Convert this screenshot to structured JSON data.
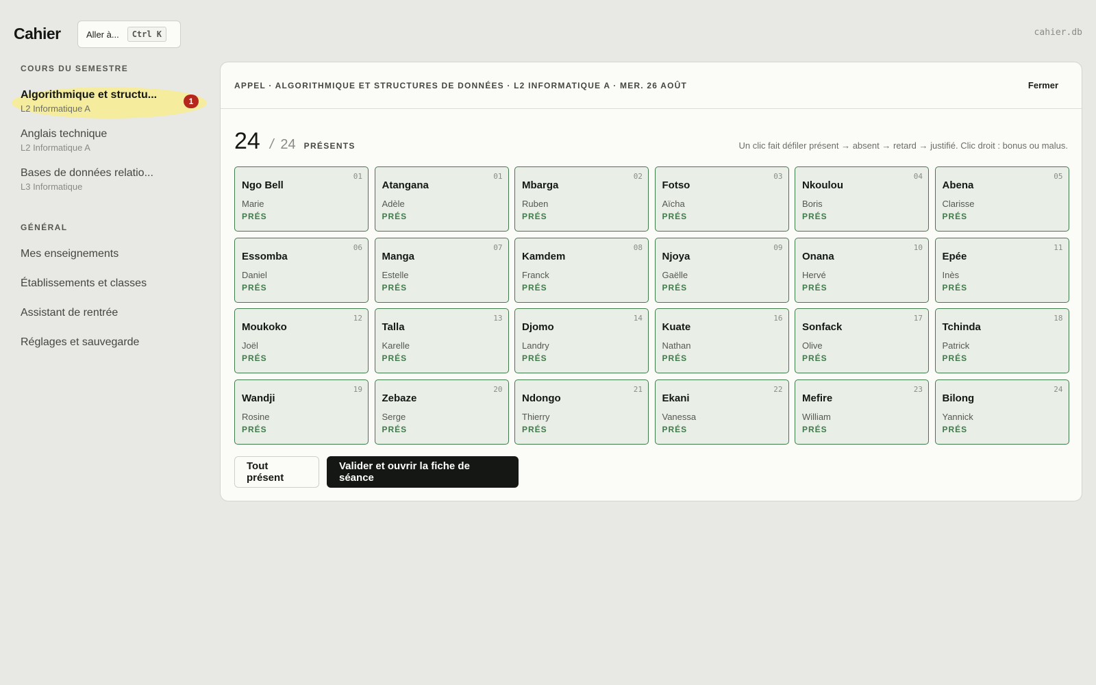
{
  "app": {
    "brand": "Cahier",
    "db_name": "cahier.db"
  },
  "goto": {
    "label": "Aller à...",
    "shortcut": "Ctrl K"
  },
  "sidebar": {
    "courses_title": "COURS DU SEMESTRE",
    "courses": [
      {
        "name": "Algorithmique et structu...",
        "class": "L2 Informatique A",
        "badge": "1",
        "active": true
      },
      {
        "name": "Anglais technique",
        "class": "L2 Informatique A"
      },
      {
        "name": "Bases de données relatio...",
        "class": "L3 Informatique"
      }
    ],
    "general_title": "GÉNÉRAL",
    "general": [
      {
        "label": "Mes enseignements"
      },
      {
        "label": "Établissements et classes"
      },
      {
        "label": "Assistant de rentrée"
      },
      {
        "label": "Réglages et sauvegarde"
      }
    ]
  },
  "panel": {
    "title": "APPEL · ALGORITHMIQUE ET STRUCTURES DE DONNÉES · L2 INFORMATIQUE A · MER. 26 AOÛT",
    "close_label": "Fermer",
    "present_count": "24",
    "separator": "/",
    "total_count": "24",
    "present_label": "PRÉSENTS",
    "hint": "Un clic fait défiler présent → absent → retard → justifié. Clic droit : bonus ou malus.",
    "accent_color": "#3f7a4a",
    "students": [
      {
        "last": "Ngo Bell",
        "first": "Marie",
        "num": "01",
        "status": "PRÉS"
      },
      {
        "last": "Atangana",
        "first": "Adèle",
        "num": "01",
        "status": "PRÉS"
      },
      {
        "last": "Mbarga",
        "first": "Ruben",
        "num": "02",
        "status": "PRÉS"
      },
      {
        "last": "Fotso",
        "first": "Aïcha",
        "num": "03",
        "status": "PRÉS"
      },
      {
        "last": "Nkoulou",
        "first": "Boris",
        "num": "04",
        "status": "PRÉS"
      },
      {
        "last": "Abena",
        "first": "Clarisse",
        "num": "05",
        "status": "PRÉS"
      },
      {
        "last": "Essomba",
        "first": "Daniel",
        "num": "06",
        "status": "PRÉS"
      },
      {
        "last": "Manga",
        "first": "Estelle",
        "num": "07",
        "status": "PRÉS"
      },
      {
        "last": "Kamdem",
        "first": "Franck",
        "num": "08",
        "status": "PRÉS"
      },
      {
        "last": "Njoya",
        "first": "Gaëlle",
        "num": "09",
        "status": "PRÉS"
      },
      {
        "last": "Onana",
        "first": "Hervé",
        "num": "10",
        "status": "PRÉS"
      },
      {
        "last": "Epée",
        "first": "Inès",
        "num": "11",
        "status": "PRÉS"
      },
      {
        "last": "Moukoko",
        "first": "Joël",
        "num": "12",
        "status": "PRÉS"
      },
      {
        "last": "Talla",
        "first": "Karelle",
        "num": "13",
        "status": "PRÉS"
      },
      {
        "last": "Djomo",
        "first": "Landry",
        "num": "14",
        "status": "PRÉS"
      },
      {
        "last": "Kuate",
        "first": "Nathan",
        "num": "16",
        "status": "PRÉS"
      },
      {
        "last": "Sonfack",
        "first": "Olive",
        "num": "17",
        "status": "PRÉS"
      },
      {
        "last": "Tchinda",
        "first": "Patrick",
        "num": "18",
        "status": "PRÉS"
      },
      {
        "last": "Wandji",
        "first": "Rosine",
        "num": "19",
        "status": "PRÉS"
      },
      {
        "last": "Zebaze",
        "first": "Serge",
        "num": "20",
        "status": "PRÉS"
      },
      {
        "last": "Ndongo",
        "first": "Thierry",
        "num": "21",
        "status": "PRÉS"
      },
      {
        "last": "Ekani",
        "first": "Vanessa",
        "num": "22",
        "status": "PRÉS"
      },
      {
        "last": "Mefire",
        "first": "William",
        "num": "23",
        "status": "PRÉS"
      },
      {
        "last": "Bilong",
        "first": "Yannick",
        "num": "24",
        "status": "PRÉS"
      }
    ],
    "btn_all_present": "Tout présent",
    "btn_validate": "Valider et ouvrir la fiche de séance"
  }
}
